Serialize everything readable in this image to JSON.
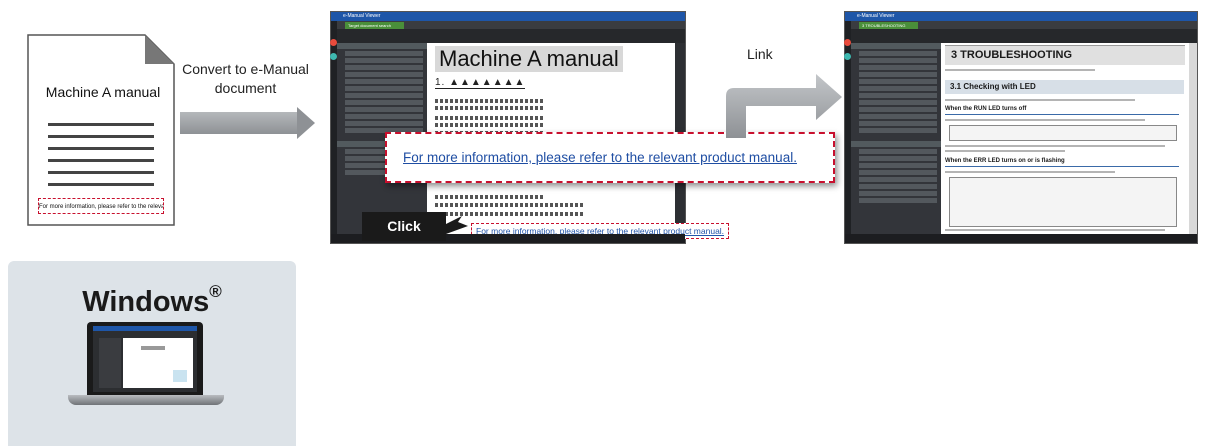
{
  "paper": {
    "label": "Machine A manual",
    "note": "For more information, please refer to the relevant product manual."
  },
  "convert": {
    "label": "Convert to e-Manual document"
  },
  "link": {
    "label": "Link"
  },
  "window1": {
    "title": "e-Manual Viewer",
    "tab": "Target document search",
    "doc_title": "Machine A manual",
    "heading": "1. ▲▲▲▲▲▲▲",
    "link_text": "For more information, please refer to the relevant product manual."
  },
  "callout": {
    "text": "For more information, please refer to the relevant product manual."
  },
  "click": {
    "label": "Click"
  },
  "window2": {
    "title": "e-Manual Viewer",
    "tab": "3 TROUBLESHOOTING",
    "h1": "3 TROUBLESHOOTING",
    "h2": "3.1 Checking with LED",
    "h3a": "When the RUN LED turns off",
    "h3b": "When the ERR LED turns on or is flashing"
  },
  "windows_card": {
    "title": "Windows",
    "mark": "®"
  },
  "colors": {
    "accent_red": "#c8102e",
    "link_blue": "#1f4ea3",
    "title_blue": "#1e56a8",
    "card_bg": "#dde3e8"
  }
}
